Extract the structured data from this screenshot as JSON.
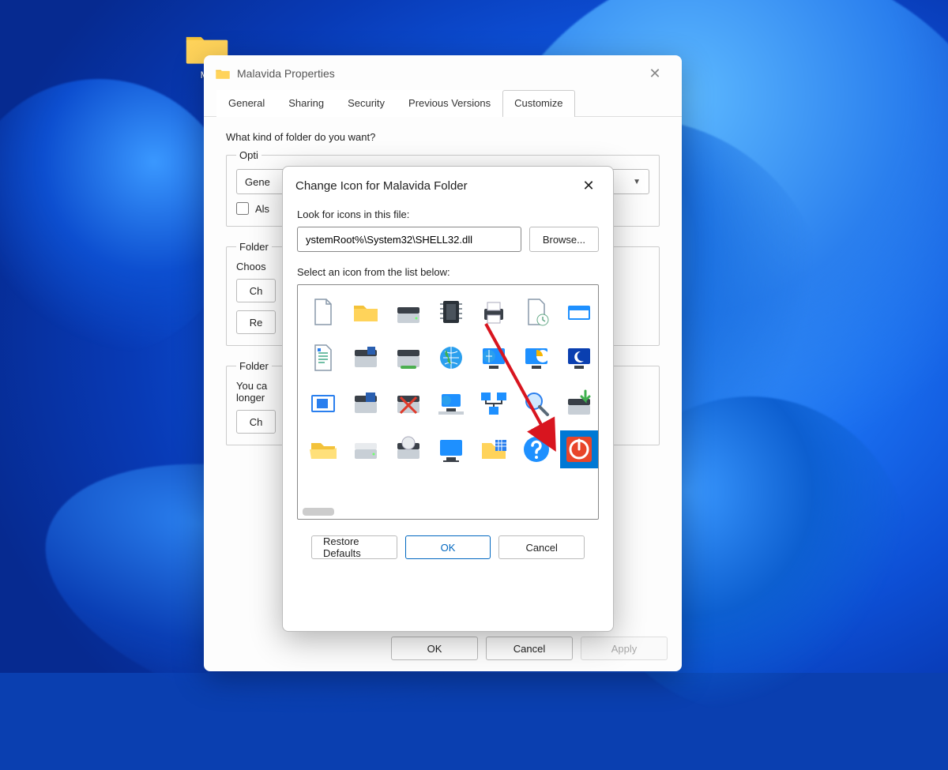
{
  "desktop": {
    "folder_label": "Ma"
  },
  "properties_window": {
    "title": "Malavida Properties",
    "tabs": [
      "General",
      "Sharing",
      "Security",
      "Previous Versions",
      "Customize"
    ],
    "active_tab_index": 4,
    "what_kind_label": "What kind of folder do you want?",
    "optimize_legend": "Opti",
    "optimize_combo_value": "Gene",
    "also_apply_label": "Als",
    "folder_pictures_legend": "Folder",
    "folder_pictures_text": "Choos",
    "choose_file_btn": "Ch",
    "restore_default_btn": "Re",
    "folder_icons_legend": "Folder",
    "folder_icons_text1": "You ca",
    "folder_icons_text2": "longer",
    "change_icon_btn": "Ch",
    "footer_ok": "OK",
    "footer_cancel": "Cancel",
    "footer_apply": "Apply"
  },
  "change_icon_window": {
    "title": "Change Icon for Malavida Folder",
    "look_label": "Look for icons in this file:",
    "path_value": "ystemRoot%\\System32\\SHELL32.dll",
    "browse_btn": "Browse...",
    "select_label": "Select an icon from the list below:",
    "restore_btn": "Restore Defaults",
    "ok_btn": "OK",
    "cancel_btn": "Cancel",
    "selected_icon_index": 27,
    "icons": [
      "blank-document",
      "folder",
      "hard-drive",
      "chip",
      "printer",
      "document-clock",
      "run-window",
      "text-document",
      "floppy-drive",
      "removable-drive",
      "globe",
      "network-monitor",
      "chart-screen",
      "night-screen",
      "window",
      "floppy-drive-alt",
      "drive-disconnected",
      "network-computer",
      "network-nodes",
      "magnifier",
      "install-drive",
      "open-folder",
      "drive",
      "optical-drive",
      "monitor",
      "folder-grid",
      "help",
      "power"
    ]
  }
}
